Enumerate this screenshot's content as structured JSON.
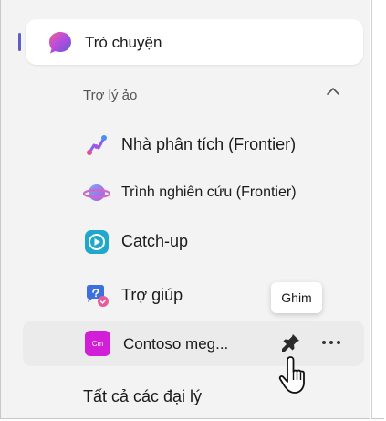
{
  "sidebar": {
    "chat": {
      "label": "Trò chuyện",
      "icon": "chat-bubble-icon"
    },
    "section": {
      "label": "Trợ lý ảo",
      "expanded": true
    },
    "agents": [
      {
        "label": "Nhà phân tích (Frontier)",
        "icon": "analyst-icon"
      },
      {
        "label": "Trình nghiên cứu (Frontier)",
        "icon": "researcher-icon"
      },
      {
        "label": "Catch-up",
        "icon": "catch-up-icon"
      },
      {
        "label": "Trợ giúp",
        "icon": "help-icon"
      }
    ],
    "hovered_agent": {
      "label": "Contoso meg...",
      "icon_text": "Cm",
      "icon": "contoso-icon"
    },
    "tooltip": "Ghim",
    "all_agents_label": "Tất cả các đại lý"
  },
  "colors": {
    "accent": "#5b5fc7",
    "contoso_icon": "#d31ed8",
    "panel_bg": "#f3f3f3"
  }
}
